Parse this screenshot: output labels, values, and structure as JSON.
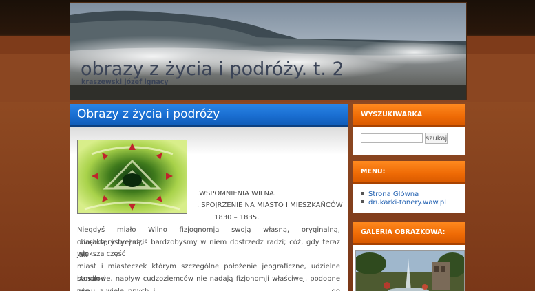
{
  "header": {
    "title": "obrazy z życia i podróży. t. 2",
    "subtitle": "kraszewski józef ignacy"
  },
  "post": {
    "title": "Obrazy z życia i podróży",
    "lines": {
      "l1": "I.WSPOMNIENIA WILNA.",
      "l2": "I. SPOJRZENIE NA MIASTO I MIESZKAŃCÓW",
      "l3": "1830 – 1835.",
      "l4": "Niegdyś miało Wilno fizjognomją swoją własną, oryginalną, charakterystyczną,",
      "l5": "odrębną, której dziś bardzobyśmy w niem dostrzedz radzi; cóż, gdy teraz jak",
      "l6": "większa część",
      "l7": "miast i miasteczek którym szczególne położenie jeograficzne, udzielne stosunki",
      "l8": "handlowe, napływ cudzoziemców nie nadają fizjonomji właściwej, podobne one do",
      "l9": "wielu, a wiele innych, i"
    }
  },
  "sidebar": {
    "search": {
      "title": "WYSZUKIWARKA",
      "placeholder": "",
      "button_label": "szukaj"
    },
    "menu": {
      "title": "MENU:",
      "items": [
        {
          "label": "Strona Główna"
        },
        {
          "label": "drukarki-tonery.waw.pl"
        }
      ]
    },
    "gallery": {
      "title": "GALERIA OBRAZKOWA:"
    }
  },
  "colors": {
    "accent_blue": "#1a6ed1",
    "accent_orange": "#ee6a05",
    "background": "#7c3a1a"
  }
}
